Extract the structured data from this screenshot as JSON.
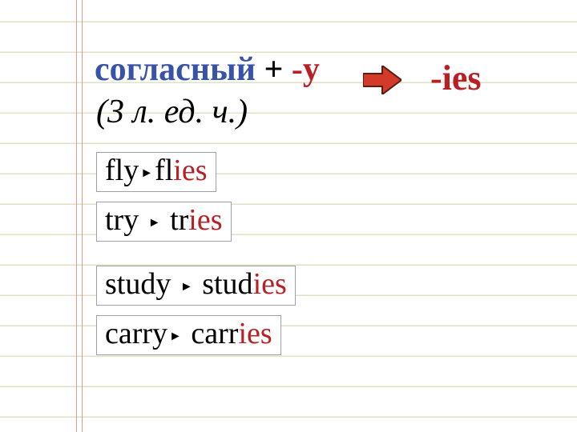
{
  "headline": {
    "consonant": "согласный",
    "plus": "+",
    "suffix_y": "-y"
  },
  "sub": "(3 л. ед. ч.)",
  "result_suffix": "-ies",
  "examples": [
    {
      "base": "fly",
      "stem": "fl",
      "ending": "ies"
    },
    {
      "base": "try",
      "stem": "tr",
      "ending": "ies"
    },
    {
      "base": "study",
      "stem": "stud",
      "ending": "ies"
    },
    {
      "base": "carry",
      "stem": "carr",
      "ending": "ies"
    }
  ]
}
